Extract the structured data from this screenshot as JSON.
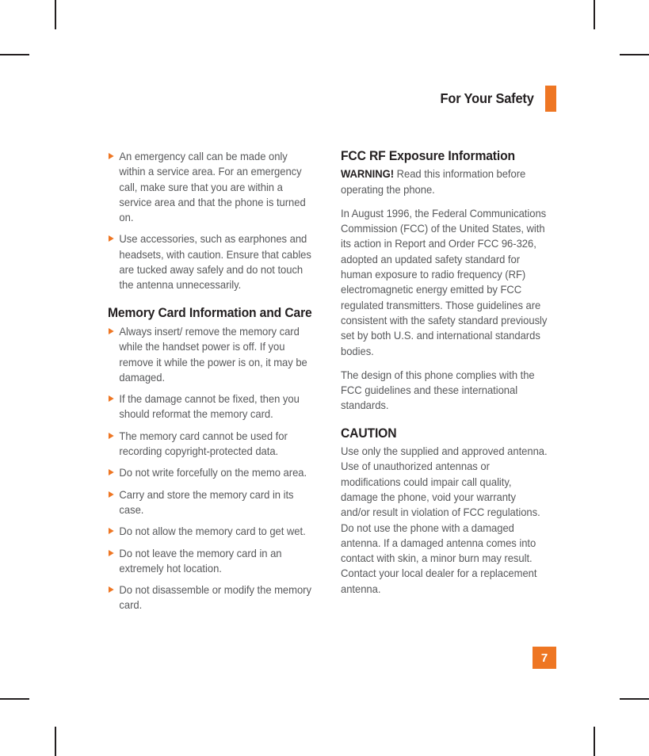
{
  "header": {
    "title": "For Your Safety",
    "accent_color": "#ee7623"
  },
  "folio": {
    "page_number": "7"
  },
  "left_column": {
    "intro_bullets": [
      "An emergency call can be made only within a service area. For an emergency call, make sure that you are within a service area and that the phone is turned on.",
      "Use accessories, such as earphones and headsets, with caution. Ensure that cables are tucked away safely and do not touch the antenna unnecessarily."
    ],
    "memory_card_heading": "Memory Card Information and Care",
    "memory_card_bullets": [
      "Always insert/ remove the memory card while the handset power is off. If you remove it while the power is on, it may be damaged.",
      "If the damage cannot be fixed, then you should reformat the memory card.",
      "The memory card cannot be used for recording copyright-protected data.",
      "Do not write forcefully on the memo area.",
      "Carry and store the memory card in its case.",
      "Do not allow the memory card to get wet.",
      "Do not leave the memory card in an extremely hot location.",
      "Do not disassemble or modify the memory card."
    ]
  },
  "right_column": {
    "fcc_heading": "FCC RF Exposure Information",
    "warning_label": "WARNING!",
    "warning_text": " Read this information before operating the phone.",
    "paragraph_august": "In August 1996, the Federal Communications Commission (FCC) of the United States, with its action in Report and Order FCC 96-326, adopted an updated safety standard for human exposure to radio frequency (RF) electromagnetic energy emitted by FCC regulated transmitters. Those guidelines are consistent with the safety standard previously set by both U.S. and international standards bodies.",
    "paragraph_design": "The design of this phone complies with the FCC guidelines and these international standards.",
    "caution_heading": "CAUTION",
    "caution_text": "Use only the supplied and approved antenna. Use of unauthorized antennas or modifications could impair call quality, damage the phone, void your warranty and/or result in violation of FCC regulations. Do not use the phone with a damaged antenna. If a damaged antenna comes into contact with skin, a minor burn may result. Contact your local dealer for a replacement antenna."
  }
}
